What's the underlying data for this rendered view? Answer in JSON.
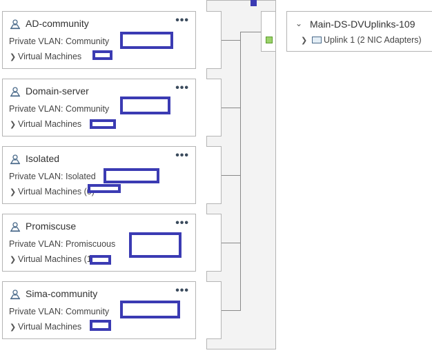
{
  "portgroups": [
    {
      "name": "AD-community",
      "vlan": "Private VLAN: Community",
      "vms": "Virtual Machines"
    },
    {
      "name": "Domain-server",
      "vlan": "Private VLAN: Community",
      "vms": "Virtual Machines"
    },
    {
      "name": "Isolated",
      "vlan": "Private VLAN: Isolated",
      "vms": "Virtual Machines (0)"
    },
    {
      "name": "Promiscuse",
      "vlan": "Private VLAN: Promiscuous",
      "vms": "Virtual Machines (1)"
    },
    {
      "name": "Sima-community",
      "vlan": "Private VLAN: Community",
      "vms": "Virtual Machines"
    }
  ],
  "more_label": "•••",
  "uplinks": {
    "title": "Main-DS-DVUplinks-109",
    "item": "Uplink 1 (2 NIC Adapters)"
  },
  "colors": {
    "redaction": "#3b3bb3",
    "uplink_port": "#9bd26a"
  },
  "icons": {
    "portgroup": "portgroup-icon",
    "nic": "nic-adapter-icon",
    "chevron": "chevron-right-icon"
  }
}
